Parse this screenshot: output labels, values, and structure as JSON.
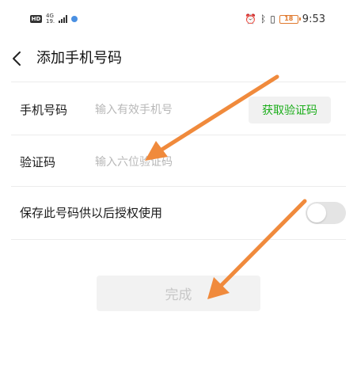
{
  "status_bar": {
    "hd": "HD",
    "network_type": "4G",
    "network_speed": "19.",
    "clock": "9:53",
    "battery_level": "18"
  },
  "header": {
    "title": "添加手机号码"
  },
  "phone_row": {
    "label": "手机号码",
    "placeholder": "输入有效手机号",
    "code_button_label": "获取验证码"
  },
  "code_row": {
    "label": "验证码",
    "placeholder": "输入六位验证码"
  },
  "save_row": {
    "label": "保存此号码供以后授权使用",
    "toggle_on": false
  },
  "done_button": {
    "label": "完成"
  },
  "colors": {
    "accent_green": "#1aad19",
    "annotation_arrow": "#f08a3c",
    "disabled_text": "#c7c7c7"
  }
}
